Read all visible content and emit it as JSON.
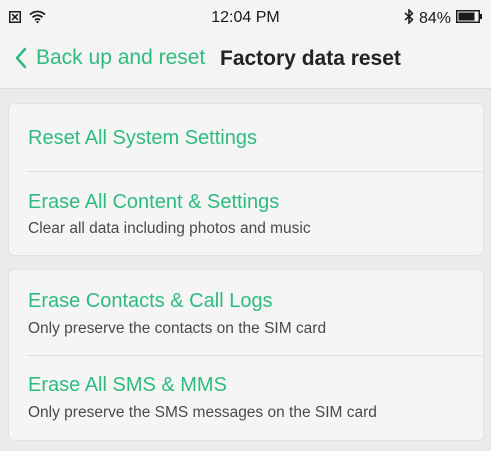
{
  "status_bar": {
    "time": "12:04 PM",
    "battery_percent": "84%",
    "battery_level": 0.84,
    "icons": {
      "notification": "close-box-icon",
      "wifi": "wifi-icon",
      "bluetooth": "bluetooth-icon",
      "battery": "battery-icon"
    }
  },
  "nav": {
    "back_label": "Back up and reset",
    "title": "Factory data reset"
  },
  "groups": [
    {
      "items": [
        {
          "title": "Reset All System Settings",
          "subtitle": ""
        },
        {
          "title": "Erase All Content & Settings",
          "subtitle": "Clear all data including photos and music"
        }
      ]
    },
    {
      "items": [
        {
          "title": "Erase Contacts & Call Logs",
          "subtitle": "Only preserve the contacts on the SIM card"
        },
        {
          "title": "Erase All SMS & MMS",
          "subtitle": "Only preserve the SMS messages on the SIM card"
        }
      ]
    }
  ],
  "colors": {
    "accent": "#2ebb7f",
    "background": "#ebebeb",
    "card": "#f5f5f5"
  }
}
